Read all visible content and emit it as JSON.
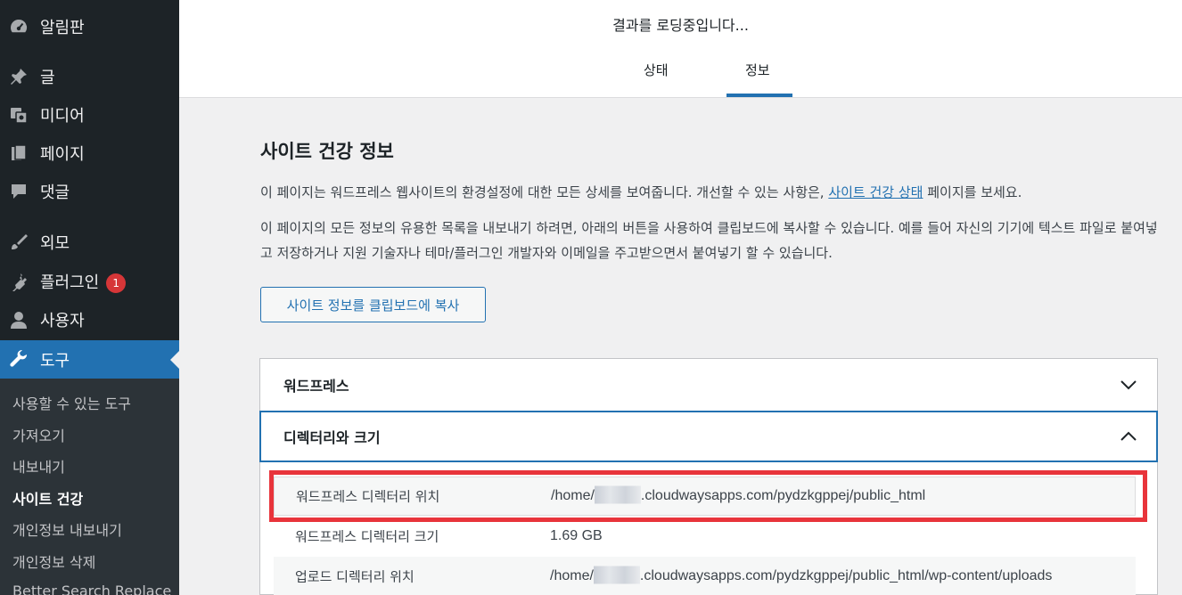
{
  "sidebar": {
    "items": [
      {
        "label": "알림판",
        "icon": "dashboard-icon"
      },
      {
        "label": "글",
        "icon": "pin-icon"
      },
      {
        "label": "미디어",
        "icon": "media-icon"
      },
      {
        "label": "페이지",
        "icon": "page-icon"
      },
      {
        "label": "댓글",
        "icon": "comment-icon"
      },
      {
        "label": "외모",
        "icon": "brush-icon"
      },
      {
        "label": "플러그인",
        "icon": "plugin-icon",
        "badge": "1"
      },
      {
        "label": "사용자",
        "icon": "user-icon"
      },
      {
        "label": "도구",
        "icon": "wrench-icon",
        "active": true
      }
    ],
    "submenu": [
      {
        "label": "사용할 수 있는 도구"
      },
      {
        "label": "가져오기"
      },
      {
        "label": "내보내기"
      },
      {
        "label": "사이트 건강",
        "current": true
      },
      {
        "label": "개인정보 내보내기"
      },
      {
        "label": "개인정보 삭제"
      },
      {
        "label": "Better Search Replace"
      }
    ]
  },
  "header": {
    "loading": "결과를 로딩중입니다...",
    "tabs": [
      {
        "label": "상태"
      },
      {
        "label": "정보",
        "active": true
      }
    ]
  },
  "main": {
    "title": "사이트 건강 정보",
    "para1_text": "이 페이지는 워드프레스 웹사이트의 환경설정에 대한 모든 상세를 보여줍니다. 개선할 수 있는 사항은, ",
    "para1_link": "사이트 건강 상태",
    "para1_tail": " 페이지를 보세요.",
    "para2": "이 페이지의 모든 정보의 유용한 목록을 내보내기 하려면, 아래의 버튼을 사용하여 클립보드에 복사할 수 있습니다. 예를 들어 자신의 기기에 텍스트 파일로 붙여넣고 저장하거나 지원 기술자나 테마/플러그인 개발자와 이메일을 주고받으면서 붙여넣기 할 수 있습니다.",
    "copy_button": "사이트 정보를 클립보드에 복사",
    "sections": [
      {
        "title": "워드프레스",
        "expanded": false
      },
      {
        "title": "디렉터리와 크기",
        "expanded": true
      }
    ],
    "rows": [
      {
        "key": "워드프레스 디렉터리 위치",
        "value_prefix": "/home/",
        "value_suffix": ".cloudwaysapps.com/pydzkgppej/public_html"
      },
      {
        "key": "워드프레스 디렉터리 크기",
        "value_prefix": "1.69 GB",
        "value_suffix": ""
      },
      {
        "key": "업로드 디렉터리 위치",
        "value_prefix": "/home/",
        "value_suffix": ".cloudwaysapps.com/pydzkgppej/public_html/wp-content/uploads"
      }
    ]
  },
  "colors": {
    "sidebar_bg": "#1d2327",
    "accent": "#2271b1",
    "highlight": "#e8343b",
    "badge": "#d63638"
  }
}
